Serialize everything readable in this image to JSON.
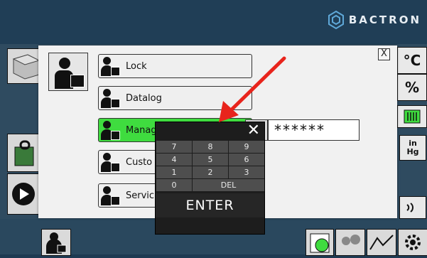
{
  "brand": {
    "logo_text": "BACTRON"
  },
  "right_panel": {
    "temp_unit": "°C",
    "percent": "%",
    "pressure_unit_top": "in",
    "pressure_unit_bottom": "Hg"
  },
  "dialog": {
    "close_label": "X",
    "users": [
      {
        "label": "Lock"
      },
      {
        "label": "Datalog"
      },
      {
        "label": "Manag"
      },
      {
        "label": "Custo"
      },
      {
        "label": "Servic"
      }
    ]
  },
  "password": {
    "masked_value": "******"
  },
  "keypad": {
    "close_label": "✕",
    "keys": [
      "7",
      "8",
      "9",
      "4",
      "5",
      "6",
      "1",
      "2",
      "3",
      "0",
      "DEL"
    ],
    "enter_label": "ENTER"
  },
  "colors": {
    "active_user": "#3fdc3f",
    "arrow": "#e8241c"
  }
}
